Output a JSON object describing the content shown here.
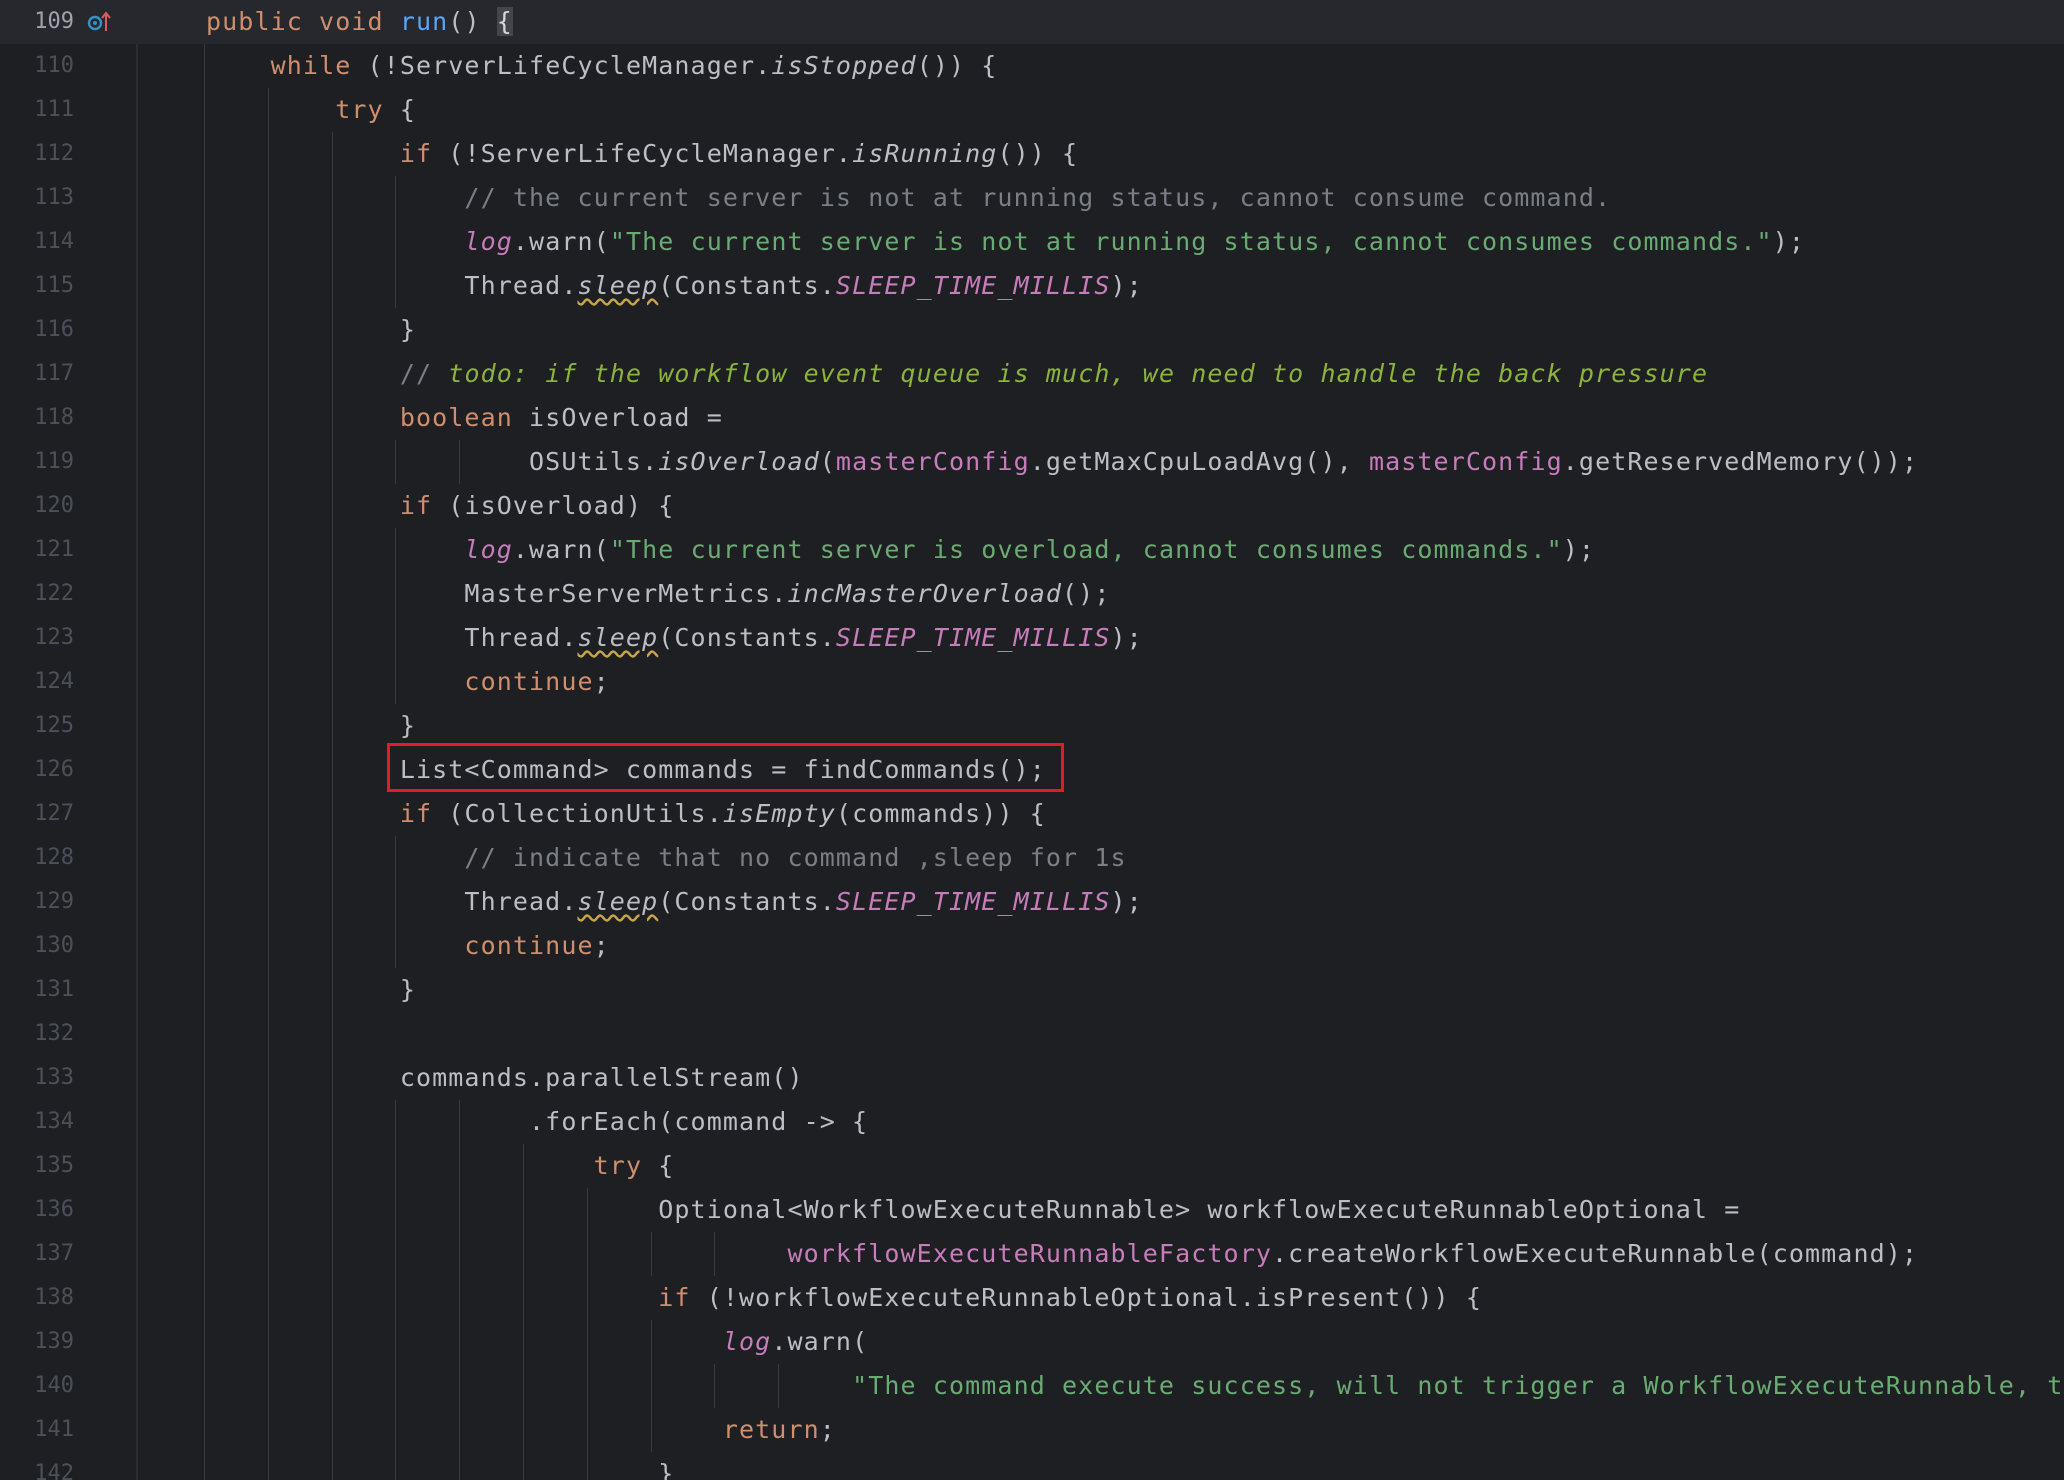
{
  "editor": {
    "current_line": 109,
    "lines": [
      {
        "n": "109",
        "tokens": [
          {
            "t": "public void ",
            "c": "kw"
          },
          {
            "t": "run",
            "c": "fn"
          },
          {
            "t": "() "
          },
          {
            "t": "{",
            "c": "caret-brace"
          }
        ]
      },
      {
        "n": "110",
        "tokens": [
          {
            "t": "    "
          },
          {
            "t": "while",
            "c": "kw"
          },
          {
            "t": " (!ServerLifeCycleManager."
          },
          {
            "t": "isStopped",
            "c": "it"
          },
          {
            "t": "()) {"
          }
        ]
      },
      {
        "n": "111",
        "tokens": [
          {
            "t": "        "
          },
          {
            "t": "try",
            "c": "kw"
          },
          {
            "t": " {"
          }
        ]
      },
      {
        "n": "112",
        "tokens": [
          {
            "t": "            "
          },
          {
            "t": "if",
            "c": "kw"
          },
          {
            "t": " (!ServerLifeCycleManager."
          },
          {
            "t": "isRunning",
            "c": "it"
          },
          {
            "t": "()) {"
          }
        ]
      },
      {
        "n": "113",
        "tokens": [
          {
            "t": "                "
          },
          {
            "t": "// the current server is not at running status, cannot consume command.",
            "c": "cm"
          }
        ]
      },
      {
        "n": "114",
        "tokens": [
          {
            "t": "                "
          },
          {
            "t": "log",
            "c": "pur it"
          },
          {
            "t": ".warn("
          },
          {
            "t": "\"The current server is not at running status, cannot consumes commands.\"",
            "c": "str"
          },
          {
            "t": ");"
          }
        ]
      },
      {
        "n": "115",
        "tokens": [
          {
            "t": "                Thread."
          },
          {
            "t": "sleep",
            "c": "it wavy"
          },
          {
            "t": "(Constants."
          },
          {
            "t": "SLEEP_TIME_MILLIS",
            "c": "pur it"
          },
          {
            "t": ");"
          }
        ]
      },
      {
        "n": "116",
        "tokens": [
          {
            "t": "            }"
          }
        ]
      },
      {
        "n": "117",
        "tokens": [
          {
            "t": "            "
          },
          {
            "t": "// ",
            "c": "cm"
          },
          {
            "t": "todo: if the workflow event queue is much, we need to handle the back pressure",
            "c": "todo"
          }
        ]
      },
      {
        "n": "118",
        "tokens": [
          {
            "t": "            "
          },
          {
            "t": "boolean",
            "c": "kw"
          },
          {
            "t": " isOverload ="
          }
        ]
      },
      {
        "n": "119",
        "tokens": [
          {
            "t": "                    OSUtils."
          },
          {
            "t": "isOverload",
            "c": "it"
          },
          {
            "t": "("
          },
          {
            "t": "masterConfig",
            "c": "pur"
          },
          {
            "t": ".getMaxCpuLoadAvg(), "
          },
          {
            "t": "masterConfig",
            "c": "pur"
          },
          {
            "t": ".getReservedMemory());"
          }
        ]
      },
      {
        "n": "120",
        "tokens": [
          {
            "t": "            "
          },
          {
            "t": "if",
            "c": "kw"
          },
          {
            "t": " (isOverload) {"
          }
        ]
      },
      {
        "n": "121",
        "tokens": [
          {
            "t": "                "
          },
          {
            "t": "log",
            "c": "pur it"
          },
          {
            "t": ".warn("
          },
          {
            "t": "\"The current server is overload, cannot consumes commands.\"",
            "c": "str"
          },
          {
            "t": ");"
          }
        ]
      },
      {
        "n": "122",
        "tokens": [
          {
            "t": "                MasterServerMetrics."
          },
          {
            "t": "incMasterOverload",
            "c": "it"
          },
          {
            "t": "();"
          }
        ]
      },
      {
        "n": "123",
        "tokens": [
          {
            "t": "                Thread."
          },
          {
            "t": "sleep",
            "c": "it wavy"
          },
          {
            "t": "(Constants."
          },
          {
            "t": "SLEEP_TIME_MILLIS",
            "c": "pur it"
          },
          {
            "t": ");"
          }
        ]
      },
      {
        "n": "124",
        "tokens": [
          {
            "t": "                "
          },
          {
            "t": "continue",
            "c": "kw"
          },
          {
            "t": ";"
          }
        ]
      },
      {
        "n": "125",
        "tokens": [
          {
            "t": "            }"
          }
        ]
      },
      {
        "n": "126",
        "tokens": [
          {
            "t": "            List<Command> commands = findCommands();"
          }
        ]
      },
      {
        "n": "127",
        "tokens": [
          {
            "t": "            "
          },
          {
            "t": "if",
            "c": "kw"
          },
          {
            "t": " (CollectionUtils."
          },
          {
            "t": "isEmpty",
            "c": "it"
          },
          {
            "t": "(commands)) {"
          }
        ]
      },
      {
        "n": "128",
        "tokens": [
          {
            "t": "                "
          },
          {
            "t": "// indicate that no command ,sleep for 1s",
            "c": "cm"
          }
        ]
      },
      {
        "n": "129",
        "tokens": [
          {
            "t": "                Thread."
          },
          {
            "t": "sleep",
            "c": "it wavy"
          },
          {
            "t": "(Constants."
          },
          {
            "t": "SLEEP_TIME_MILLIS",
            "c": "pur it"
          },
          {
            "t": ");"
          }
        ]
      },
      {
        "n": "130",
        "tokens": [
          {
            "t": "                "
          },
          {
            "t": "continue",
            "c": "kw"
          },
          {
            "t": ";"
          }
        ]
      },
      {
        "n": "131",
        "tokens": [
          {
            "t": "            }"
          }
        ]
      },
      {
        "n": "132",
        "tokens": [
          {
            "t": ""
          }
        ]
      },
      {
        "n": "133",
        "tokens": [
          {
            "t": "            commands.parallelStream()"
          }
        ]
      },
      {
        "n": "134",
        "tokens": [
          {
            "t": "                    .forEach(command -> {"
          }
        ]
      },
      {
        "n": "135",
        "tokens": [
          {
            "t": "                        "
          },
          {
            "t": "try",
            "c": "kw"
          },
          {
            "t": " {"
          }
        ]
      },
      {
        "n": "136",
        "tokens": [
          {
            "t": "                            Optional<WorkflowExecuteRunnable> workflowExecuteRunnableOptional ="
          }
        ]
      },
      {
        "n": "137",
        "tokens": [
          {
            "t": "                                    "
          },
          {
            "t": "workflowExecuteRunnableFactory",
            "c": "pur"
          },
          {
            "t": ".createWorkflowExecuteRunnable(command);"
          }
        ]
      },
      {
        "n": "138",
        "tokens": [
          {
            "t": "                            "
          },
          {
            "t": "if",
            "c": "kw"
          },
          {
            "t": " (!workflowExecuteRunnableOptional.isPresent()) {"
          }
        ]
      },
      {
        "n": "139",
        "tokens": [
          {
            "t": "                                "
          },
          {
            "t": "log",
            "c": "pur it"
          },
          {
            "t": ".warn("
          }
        ]
      },
      {
        "n": "140",
        "tokens": [
          {
            "t": "                                        "
          },
          {
            "t": "\"The command execute success, will not trigger a WorkflowExecuteRunnable, th",
            "c": "str"
          }
        ]
      },
      {
        "n": "141",
        "tokens": [
          {
            "t": "                                "
          },
          {
            "t": "return",
            "c": "kw"
          },
          {
            "t": ";"
          }
        ]
      },
      {
        "n": "142",
        "tokens": [
          {
            "t": "                            }"
          }
        ]
      }
    ],
    "highlighted_line": 126,
    "colors": {
      "background": "#1e1f22",
      "keyword": "#cf8e6d",
      "function_decl": "#56a8f5",
      "field": "#c77dbb",
      "string": "#6aab73",
      "comment": "#7a7e85",
      "todo": "#8bb33d",
      "highlight_box": "#e21c24"
    },
    "gutter_icon": "override-method-icon"
  }
}
